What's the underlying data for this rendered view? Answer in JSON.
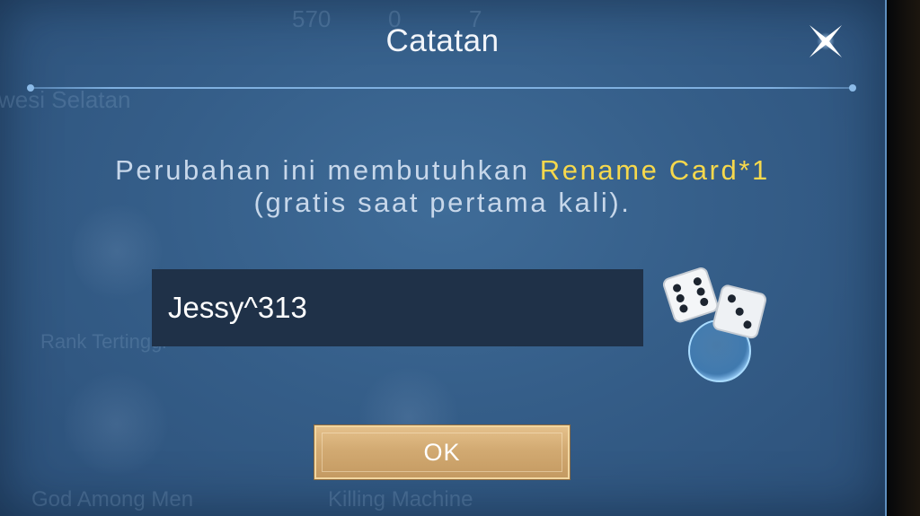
{
  "dialog": {
    "title": "Catatan",
    "close_icon": "close-x-icon",
    "message_prefix": "Perubahan ini membutuhkan ",
    "message_highlight": "Rename Card*1",
    "message_suffix": "(gratis saat pertama kali).",
    "name_value": "Jessy^313",
    "randomize_icon": "dice-icon",
    "ok_label": "OK"
  },
  "background": {
    "stat_1": "570",
    "stat_2": "0",
    "stat_3": "7",
    "region": "wesi Selatan",
    "badge_1_label": "Rank Tertinggi",
    "badge_2_label": "God Among Men",
    "badge_3_label": "Killing Machine"
  },
  "colors": {
    "panel": "#355e89",
    "highlight": "#f6d84c",
    "input_bg": "#1f3148",
    "ok_button": "#d2aa72"
  }
}
